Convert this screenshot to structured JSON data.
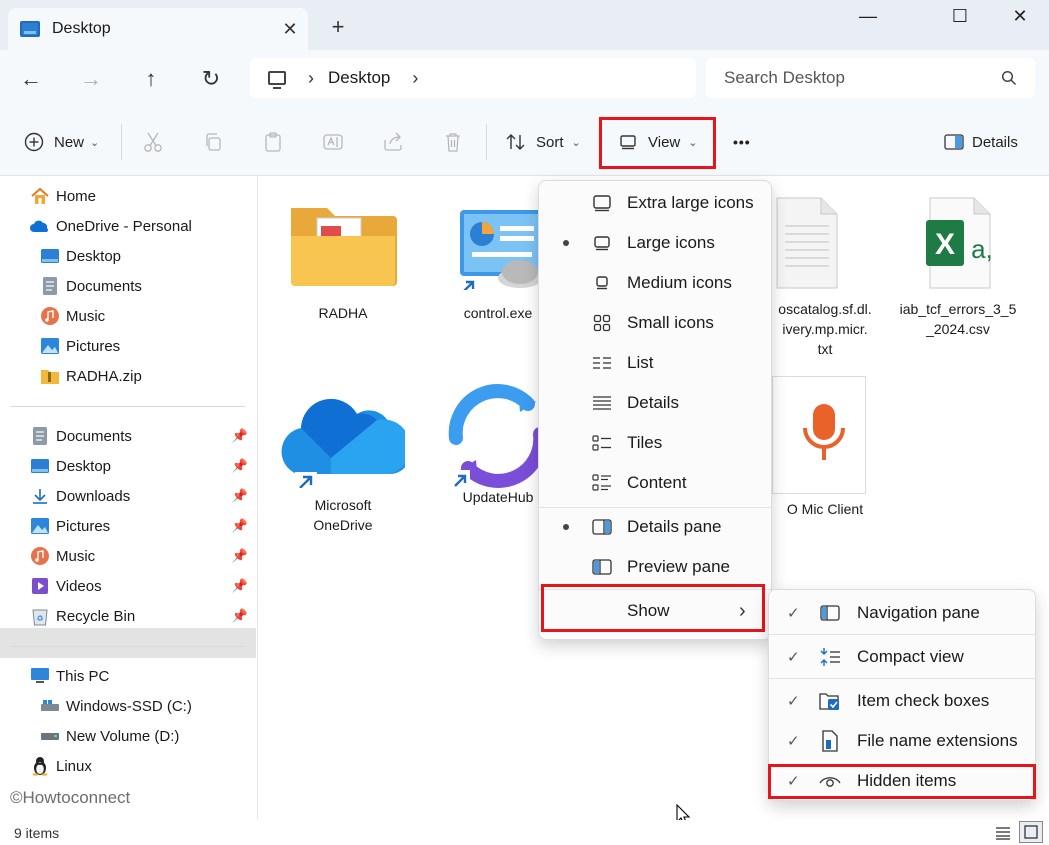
{
  "window": {
    "tab_title": "Desktop",
    "tab_close": "✕",
    "new_tab": "+",
    "minimize": "—",
    "maximize": "☐",
    "close": "✕"
  },
  "nav": {
    "back": "←",
    "forward": "→",
    "up": "↑",
    "refresh": "↻",
    "breadcrumb": [
      "Desktop"
    ],
    "search_placeholder": "Search Desktop"
  },
  "toolbar": {
    "new_label": "New",
    "sort_label": "Sort",
    "view_label": "View",
    "more_label": "•••",
    "details_label": "Details",
    "accent": "#0067c0",
    "highlight": "#e8141b"
  },
  "sidebar": {
    "group1": [
      {
        "label": "Home",
        "icon": "home-icon"
      },
      {
        "label": "OneDrive - Personal",
        "icon": "onedrive-icon"
      },
      {
        "label": "Desktop",
        "icon": "desktop-icon"
      },
      {
        "label": "Documents",
        "icon": "documents-icon"
      },
      {
        "label": "Music",
        "icon": "music-icon"
      },
      {
        "label": "Pictures",
        "icon": "pictures-icon"
      },
      {
        "label": "RADHA.zip",
        "icon": "zip-folder-icon"
      }
    ],
    "group2": [
      {
        "label": "Documents",
        "icon": "documents-icon"
      },
      {
        "label": "Desktop",
        "icon": "desktop-icon",
        "selected": true
      },
      {
        "label": "Downloads",
        "icon": "downloads-icon"
      },
      {
        "label": "Pictures",
        "icon": "pictures-icon"
      },
      {
        "label": "Music",
        "icon": "music-icon"
      },
      {
        "label": "Videos",
        "icon": "videos-icon"
      },
      {
        "label": "Recycle Bin",
        "icon": "recycle-bin-icon"
      }
    ],
    "group3": [
      {
        "label": "This PC",
        "icon": "pc-icon"
      },
      {
        "label": "Windows-SSD (C:)",
        "icon": "drive-icon"
      },
      {
        "label": "New Volume (D:)",
        "icon": "drive-icon"
      },
      {
        "label": "Linux",
        "icon": "linux-icon"
      }
    ]
  },
  "files": [
    {
      "name": "RADHA"
    },
    {
      "name": "control.exe"
    },
    {
      "name": "oscatalog.sf.dl.\nivery.mp.micr.\ntxt"
    },
    {
      "name": "iab_tcf_errors_3_5\n_2024.csv"
    },
    {
      "name": "Microsoft\nOneDrive"
    },
    {
      "name": "UpdateHub"
    },
    {
      "name": "O Mic Client"
    }
  ],
  "view_menu": {
    "items": [
      {
        "label": "Extra large icons",
        "icon": "extra-large-icons-icon",
        "selected": false
      },
      {
        "label": "Large icons",
        "icon": "large-icons-icon",
        "selected": true
      },
      {
        "label": "Medium icons",
        "icon": "medium-icons-icon",
        "selected": false
      },
      {
        "label": "Small icons",
        "icon": "small-icons-icon",
        "selected": false
      },
      {
        "label": "List",
        "icon": "list-icon",
        "selected": false
      },
      {
        "label": "Details",
        "icon": "details-icon",
        "selected": false
      },
      {
        "label": "Tiles",
        "icon": "tiles-icon",
        "selected": false
      },
      {
        "label": "Content",
        "icon": "content-icon",
        "selected": false
      }
    ],
    "panes": [
      {
        "label": "Details pane",
        "icon": "details-pane-icon",
        "selected": true
      },
      {
        "label": "Preview pane",
        "icon": "preview-pane-icon",
        "selected": false
      }
    ],
    "show_label": "Show",
    "show_chevron": "›"
  },
  "show_submenu": {
    "items": [
      {
        "label": "Navigation pane",
        "icon": "navigation-pane-icon",
        "checked": true
      },
      {
        "label": "Compact view",
        "icon": "compact-view-icon",
        "checked": true
      },
      {
        "label": "Item check boxes",
        "icon": "item-check-boxes-icon",
        "checked": true
      },
      {
        "label": "File name extensions",
        "icon": "file-extensions-icon",
        "checked": true
      },
      {
        "label": "Hidden items",
        "icon": "hidden-items-icon",
        "checked": true
      }
    ],
    "check_glyph": "✓"
  },
  "status": {
    "item_count": "9 items"
  },
  "watermark": "©Howtoconnect"
}
